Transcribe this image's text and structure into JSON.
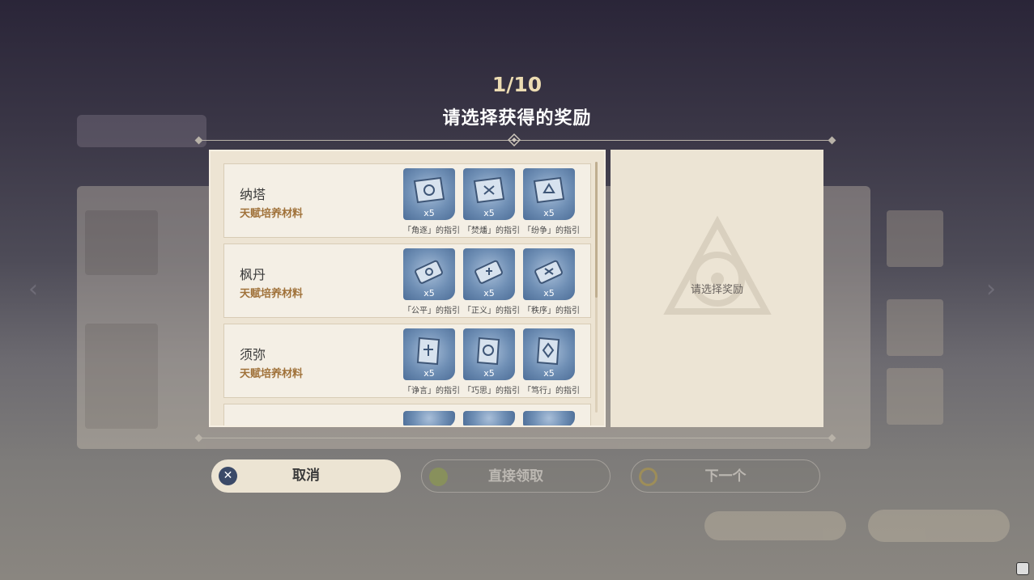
{
  "header": {
    "counter": "1/10",
    "title": "请选择获得的奖励"
  },
  "regions": [
    {
      "name": "纳塔",
      "category": "天赋培养材料",
      "items": [
        {
          "label": "「角逐」的指引",
          "qty": "x5",
          "icon": "scroll-book-icon"
        },
        {
          "label": "「焚燔」的指引",
          "qty": "x5",
          "icon": "scroll-book-icon"
        },
        {
          "label": "「纷争」的指引",
          "qty": "x5",
          "icon": "scroll-book-icon"
        }
      ]
    },
    {
      "name": "枫丹",
      "category": "天赋培养材料",
      "items": [
        {
          "label": "「公平」的指引",
          "qty": "x5",
          "icon": "rolled-scroll-icon"
        },
        {
          "label": "「正义」的指引",
          "qty": "x5",
          "icon": "rolled-scroll-icon"
        },
        {
          "label": "「秩序」的指引",
          "qty": "x5",
          "icon": "rolled-scroll-icon"
        }
      ]
    },
    {
      "name": "须弥",
      "category": "天赋培养材料",
      "items": [
        {
          "label": "「诤言」的指引",
          "qty": "x5",
          "icon": "tablet-book-icon"
        },
        {
          "label": "「巧思」的指引",
          "qty": "x5",
          "icon": "tablet-book-icon"
        },
        {
          "label": "「笃行」的指引",
          "qty": "x5",
          "icon": "tablet-book-icon"
        }
      ]
    }
  ],
  "preview": {
    "placeholder": "请选择奖励"
  },
  "buttons": {
    "cancel": "取消",
    "claim": "直接领取",
    "next": "下一个"
  },
  "colors": {
    "accent_gold": "#ecdcb2",
    "category_text": "#a0723a",
    "item_tile": "#6f8fb5",
    "panel": "#ede4d3"
  }
}
